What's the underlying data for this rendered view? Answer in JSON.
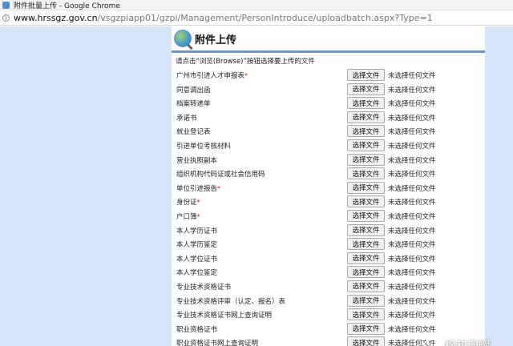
{
  "window": {
    "title": "附件批量上传 - Google Chrome"
  },
  "address_bar": {
    "host": "www.hrssgz.gov.cn",
    "path": "/vsgzpiapp01/gzpi/Management/PersonIntroduce/uploadbatch.aspx?Type=1"
  },
  "page": {
    "title": "附件上传",
    "instruction": "请点击“浏览(Browse)”按钮选择要上传的文件",
    "required_mark": "*",
    "button_label": "选择文件",
    "status_text": "未选择任何文件"
  },
  "documents": [
    {
      "label": "广州市引进人才申报表",
      "required": "*"
    },
    {
      "label": "同意调出函",
      "required": ""
    },
    {
      "label": "档案转递单",
      "required": ""
    },
    {
      "label": "承诺书",
      "required": ""
    },
    {
      "label": "就业登记表",
      "required": ""
    },
    {
      "label": "引进单位考核材料",
      "required": ""
    },
    {
      "label": "营业执照副本",
      "required": ""
    },
    {
      "label": "组织机构代码证或社会信用码",
      "required": ""
    },
    {
      "label": "单位引进报告",
      "required": "*"
    },
    {
      "label": "身份证",
      "required": "*"
    },
    {
      "label": "户口簿",
      "required": "*"
    },
    {
      "label": "本人学历证书",
      "required": ""
    },
    {
      "label": "本人学历鉴定",
      "required": ""
    },
    {
      "label": "本人学位证书",
      "required": ""
    },
    {
      "label": "本人学位鉴定",
      "required": ""
    },
    {
      "label": "专业技术资格证书",
      "required": ""
    },
    {
      "label": "专业技术资格评审（认定、报名）表",
      "required": ""
    },
    {
      "label": "专业技术资格证书网上查询证明",
      "required": ""
    },
    {
      "label": "职业资格证书",
      "required": ""
    },
    {
      "label": "职业资格证书网上查询证明",
      "required": ""
    }
  ],
  "watermark": {
    "text": "枫和羽曜"
  }
}
